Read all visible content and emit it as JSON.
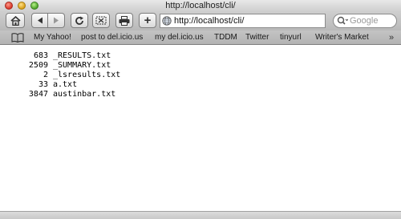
{
  "window": {
    "title": "http://localhost/cli/"
  },
  "toolbar": {
    "add_label": "+",
    "address": "http://localhost/cli/",
    "search_placeholder": "Google"
  },
  "bookmarks": {
    "items": [
      "My Yahoo!",
      "post to del.icio.us",
      "my del.icio.us",
      "TDDM",
      "Twitter",
      "tinyurl",
      "Writer's Market"
    ],
    "overflow": "»"
  },
  "listing": {
    "rows": [
      {
        "count": "683",
        "name": "_RESULTS.txt"
      },
      {
        "count": "2509",
        "name": "_SUMMARY.txt"
      },
      {
        "count": "2",
        "name": "_lsresults.txt"
      },
      {
        "count": "33",
        "name": "a.txt"
      },
      {
        "count": "3847",
        "name": "austinbar.txt"
      }
    ]
  },
  "icons": [
    "home-icon",
    "back-arrow-icon",
    "forward-arrow-icon",
    "reload-icon",
    "snip-icon",
    "print-icon",
    "globe-icon",
    "search-icon",
    "bookmarks-book-icon"
  ],
  "colors": {
    "close": "#d8362a",
    "minimize": "#d9a018",
    "zoom": "#4ea52a"
  }
}
